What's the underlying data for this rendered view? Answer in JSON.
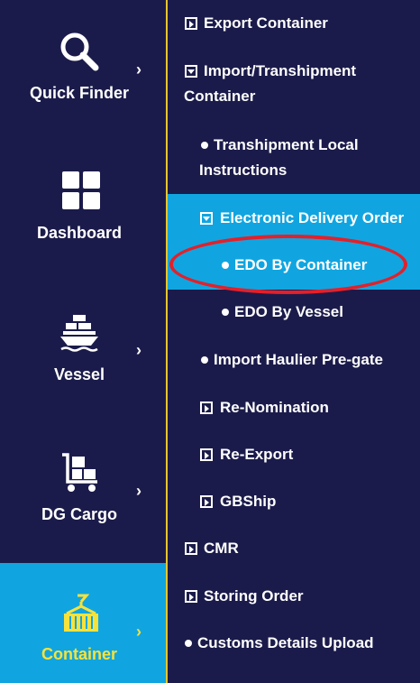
{
  "rail": {
    "items": [
      {
        "label": "Quick Finder",
        "icon": "magnifier-icon",
        "has_chevron": true
      },
      {
        "label": "Dashboard",
        "icon": "grid-icon",
        "has_chevron": false
      },
      {
        "label": "Vessel",
        "icon": "ship-icon",
        "has_chevron": true
      },
      {
        "label": "DG Cargo",
        "icon": "trolley-icon",
        "has_chevron": true
      },
      {
        "label": "Container",
        "icon": "container-crane-icon",
        "has_chevron": true,
        "active": true
      }
    ],
    "chevron": "›"
  },
  "submenu": {
    "items": [
      {
        "label": "Export Container",
        "icon": "expand-box-icon"
      },
      {
        "label": "Import/Transhipment",
        "label2": "Container",
        "icon": "collapse-box-icon"
      },
      {
        "label": "Transhipment Local",
        "label2": "Instructions",
        "icon": "bullet-icon"
      },
      {
        "label": "Electronic Delivery Order",
        "icon": "collapse-box-icon",
        "highlighted": true
      },
      {
        "label": "EDO By Container",
        "icon": "bullet-icon",
        "highlighted": true,
        "circled": true
      },
      {
        "label": "EDO By Vessel",
        "icon": "bullet-icon"
      },
      {
        "label": "Import Haulier Pre-gate",
        "icon": "bullet-icon"
      },
      {
        "label": "Re-Nomination",
        "icon": "expand-box-icon"
      },
      {
        "label": "Re-Export",
        "icon": "expand-box-icon"
      },
      {
        "label": "GBShip",
        "icon": "expand-box-icon"
      },
      {
        "label": "CMR",
        "icon": "expand-box-icon"
      },
      {
        "label": "Storing Order",
        "icon": "expand-box-icon"
      },
      {
        "label": "Customs Details Upload",
        "icon": "bullet-icon"
      }
    ]
  },
  "colors": {
    "background": "#1b1b4b",
    "accent_blue": "#10a5e0",
    "accent_yellow": "#f7e23b",
    "annotation_red": "#e3202a"
  }
}
